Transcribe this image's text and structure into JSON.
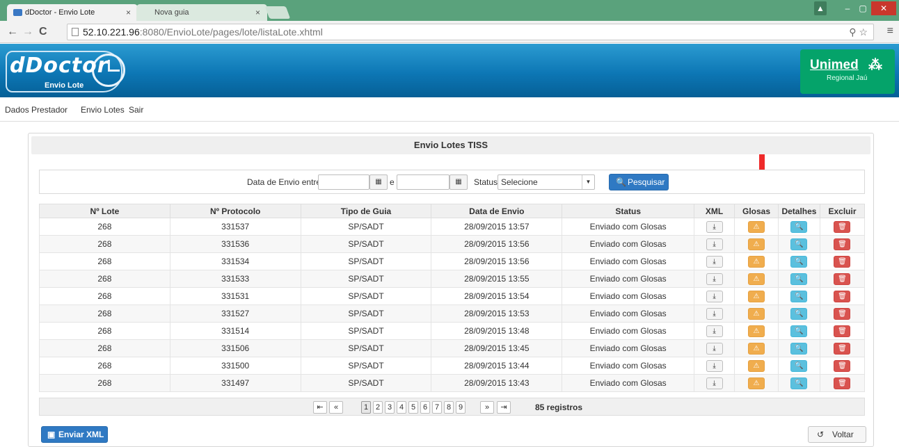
{
  "browser": {
    "tabs": [
      {
        "label": "dDoctor - Envio Lote",
        "close": "×"
      },
      {
        "label": "Nova guia",
        "close": "×"
      }
    ],
    "url_host": "52.10.221.96",
    "url_path": ":8080/EnvioLote/pages/lote/listaLote.xhtml"
  },
  "header": {
    "logo_text": "dDoctor",
    "logo_sub": "Envio Lote",
    "partner_name": "Unimed",
    "partner_sub": "Regional Jaú"
  },
  "menu": {
    "items": [
      "Dados Prestador",
      "Envio Lotes",
      "Sair"
    ]
  },
  "panel": {
    "title": "Envio Lotes TISS"
  },
  "filter": {
    "date_label": "Data de Envio entre",
    "between": "e",
    "status_label": "Status",
    "status_value": "Selecione",
    "search_button": "Pesquisar"
  },
  "table": {
    "columns": [
      "Nº Lote",
      "Nº Protocolo",
      "Tipo de Guia",
      "Data de Envio",
      "Status",
      "XML",
      "Glosas",
      "Detalhes",
      "Excluir"
    ],
    "rows": [
      {
        "lote": "268",
        "protocolo": "331537",
        "tipo": "SP/SADT",
        "data": "28/09/2015 13:57",
        "status": "Enviado com Glosas"
      },
      {
        "lote": "268",
        "protocolo": "331536",
        "tipo": "SP/SADT",
        "data": "28/09/2015 13:56",
        "status": "Enviado com Glosas"
      },
      {
        "lote": "268",
        "protocolo": "331534",
        "tipo": "SP/SADT",
        "data": "28/09/2015 13:56",
        "status": "Enviado com Glosas"
      },
      {
        "lote": "268",
        "protocolo": "331533",
        "tipo": "SP/SADT",
        "data": "28/09/2015 13:55",
        "status": "Enviado com Glosas"
      },
      {
        "lote": "268",
        "protocolo": "331531",
        "tipo": "SP/SADT",
        "data": "28/09/2015 13:54",
        "status": "Enviado com Glosas"
      },
      {
        "lote": "268",
        "protocolo": "331527",
        "tipo": "SP/SADT",
        "data": "28/09/2015 13:53",
        "status": "Enviado com Glosas"
      },
      {
        "lote": "268",
        "protocolo": "331514",
        "tipo": "SP/SADT",
        "data": "28/09/2015 13:48",
        "status": "Enviado com Glosas"
      },
      {
        "lote": "268",
        "protocolo": "331506",
        "tipo": "SP/SADT",
        "data": "28/09/2015 13:45",
        "status": "Enviado com Glosas"
      },
      {
        "lote": "268",
        "protocolo": "331500",
        "tipo": "SP/SADT",
        "data": "28/09/2015 13:44",
        "status": "Enviado com Glosas"
      },
      {
        "lote": "268",
        "protocolo": "331497",
        "tipo": "SP/SADT",
        "data": "28/09/2015 13:43",
        "status": "Enviado com Glosas"
      }
    ]
  },
  "pager": {
    "first": "⏮",
    "prev": "⏪",
    "next": "⏩",
    "last": "⏭",
    "pages": [
      "1",
      "2",
      "3",
      "4",
      "5",
      "6",
      "7",
      "8",
      "9"
    ],
    "current_page": "1",
    "count": "85 registros"
  },
  "footer": {
    "send_button": "Enviar XML",
    "back_button": "Voltar"
  },
  "colors": {
    "primary": "#2f79c3",
    "warning": "#f0ad4e",
    "info": "#5bc0de",
    "danger": "#d9534f",
    "annotation_arrow": "#ef2a2a"
  }
}
